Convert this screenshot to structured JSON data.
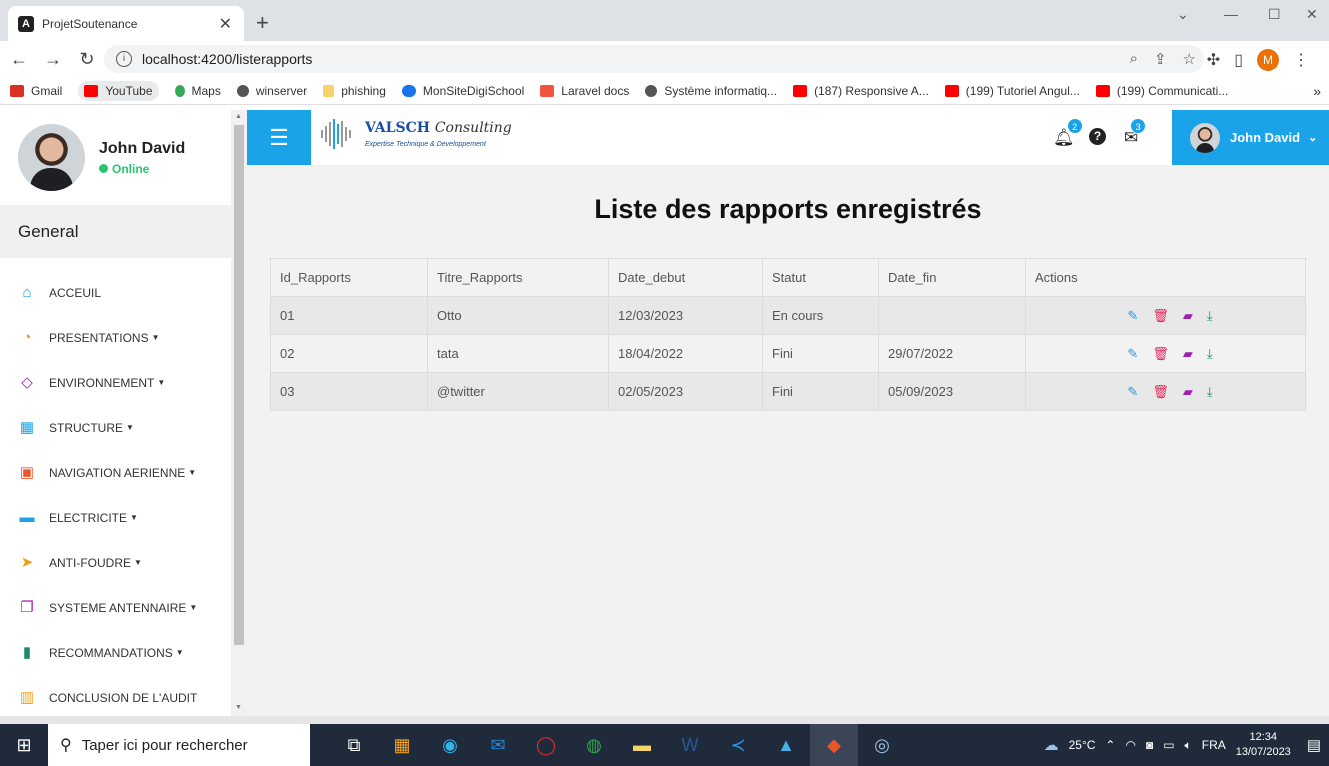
{
  "browser": {
    "tab_title": "ProjetSoutenance",
    "url": "localhost:4200/listerapports",
    "profile_initial": "M",
    "bookmarks": [
      "Gmail",
      "YouTube",
      "Maps",
      "winserver",
      "phishing",
      "MonSiteDigiSchool",
      "Laravel docs",
      "Système informatiq...",
      "(187) Responsive A...",
      "(199) Tutoriel Angul...",
      "(199) Communicati..."
    ],
    "more_bookmarks": "»"
  },
  "sidebar": {
    "user_name": "John David",
    "status": "Online",
    "section": "General",
    "items": [
      {
        "label": "ACCEUIL",
        "icon": "home-icon",
        "glyph": "⌂",
        "color": "#1aa3e8",
        "caret": false
      },
      {
        "label": "PRESENTATIONS",
        "icon": "clock-icon",
        "glyph": "◔",
        "color": "#f29d12",
        "caret": true
      },
      {
        "label": "ENVIRONNEMENT",
        "icon": "diamond-icon",
        "glyph": "◇",
        "color": "#a020b0",
        "caret": true
      },
      {
        "label": "STRUCTURE",
        "icon": "table-icon",
        "glyph": "▦",
        "color": "#1aa3e8",
        "caret": true
      },
      {
        "label": "NAVIGATION AERIENNE",
        "icon": "frame-icon",
        "glyph": "▣",
        "color": "#e8562a",
        "caret": true
      },
      {
        "label": "ELECTRICITE",
        "icon": "briefcase-icon",
        "glyph": "▬",
        "color": "#1aa3e8",
        "caret": true
      },
      {
        "label": "ANTI-FOUDRE",
        "icon": "paper-plane-icon",
        "glyph": "➤",
        "color": "#f29d12",
        "caret": true
      },
      {
        "label": "SYSTEME ANTENNAIRE",
        "icon": "clone-icon",
        "glyph": "❐",
        "color": "#a020b0",
        "caret": true
      },
      {
        "label": "RECOMMANDATIONS",
        "icon": "map-icon",
        "glyph": "▮",
        "color": "#1a8a6a",
        "caret": true
      },
      {
        "label": "CONCLUSION DE L'AUDIT",
        "icon": "bar-chart-icon",
        "glyph": "▥",
        "color": "#f29d12",
        "caret": false
      }
    ]
  },
  "header": {
    "logo_main": "VALSCH",
    "logo_accent": "Consulting",
    "logo_tagline": "Expertise Technique & Developpement",
    "notif_count": "2",
    "mail_count": "3",
    "user_name": "John David"
  },
  "page": {
    "title": "Liste des rapports enregistrés",
    "columns": [
      "Id_Rapports",
      "Titre_Rapports",
      "Date_debut",
      "Statut",
      "Date_fin",
      "Actions"
    ],
    "rows": [
      {
        "id": "01",
        "titre": "Otto",
        "debut": "12/03/2023",
        "statut": "En cours",
        "fin": ""
      },
      {
        "id": "02",
        "titre": "tata",
        "debut": "18/04/2022",
        "statut": "Fini",
        "fin": "29/07/2022"
      },
      {
        "id": "03",
        "titre": "@twitter",
        "debut": "02/05/2023",
        "statut": "Fini",
        "fin": "05/09/2023"
      }
    ],
    "action_colors": {
      "edit": "#1aa3e8",
      "delete": "#e8245a",
      "folder": "#a020b0",
      "download": "#1a8a6a"
    }
  },
  "taskbar": {
    "search_placeholder": "Taper ici pour rechercher",
    "weather": "25°C",
    "lang": "FRA",
    "time": "12:34",
    "date": "13/07/2023"
  }
}
